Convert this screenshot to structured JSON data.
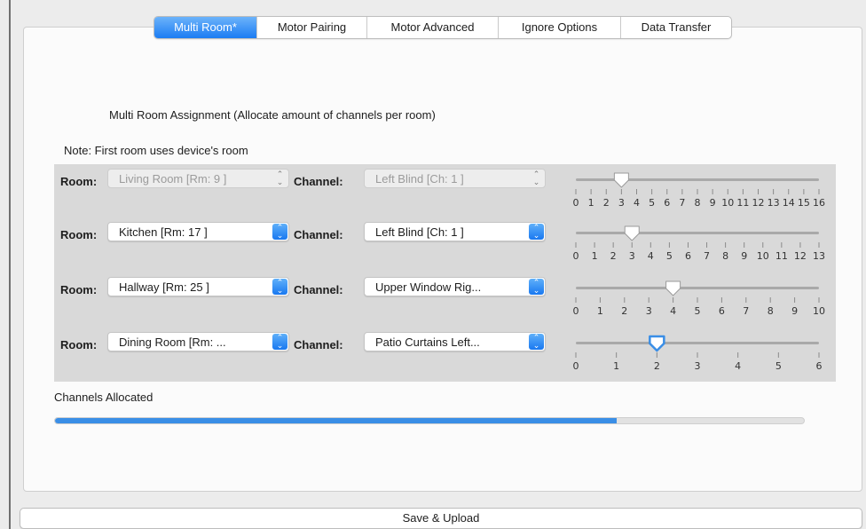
{
  "tabs": [
    {
      "label": "Multi Room*",
      "active": true
    },
    {
      "label": "Motor Pairing",
      "active": false
    },
    {
      "label": "Motor Advanced",
      "active": false
    },
    {
      "label": "Ignore Options",
      "active": false
    },
    {
      "label": "Data Transfer",
      "active": false
    }
  ],
  "assignment": {
    "title": "Multi Room Assignment (Allocate amount of channels per room)",
    "note": "Note: First room uses device's room"
  },
  "labels": {
    "room": "Room:",
    "channel": "Channel:"
  },
  "rows": [
    {
      "room": "Living Room [Rm: 9 ]",
      "channel": "Left Blind [Ch: 1 ]",
      "disabled": true,
      "slider": {
        "min": 0,
        "max": 16,
        "value": 3,
        "ticks": [
          "0",
          "1",
          "2",
          "3",
          "4",
          "5",
          "6",
          "7",
          "8",
          "9",
          "10",
          "11",
          "12",
          "13",
          "14",
          "15",
          "16"
        ]
      }
    },
    {
      "room": "Kitchen [Rm: 17 ]",
      "channel": "Left Blind [Ch: 1 ]",
      "disabled": false,
      "slider": {
        "min": 0,
        "max": 13,
        "value": 3,
        "ticks": [
          "0",
          "1",
          "2",
          "3",
          "4",
          "5",
          "6",
          "7",
          "8",
          "9",
          "10",
          "11",
          "12",
          "13"
        ]
      }
    },
    {
      "room": "Hallway [Rm: 25 ]",
      "channel": "Upper Window Rig...",
      "disabled": false,
      "slider": {
        "min": 0,
        "max": 10,
        "value": 4,
        "ticks": [
          "0",
          "1",
          "2",
          "3",
          "4",
          "5",
          "6",
          "7",
          "8",
          "9",
          "10"
        ]
      }
    },
    {
      "room": "Dining Room [Rm: ...",
      "channel": "Patio Curtains Left...",
      "disabled": false,
      "slider": {
        "min": 0,
        "max": 6,
        "value": 2,
        "focused": true,
        "ticks": [
          "0",
          "1",
          "2",
          "3",
          "4",
          "5",
          "6"
        ]
      }
    }
  ],
  "channels_allocated": {
    "label": "Channels Allocated",
    "fraction": 0.75
  },
  "save_button": "Save & Upload",
  "colors": {
    "accent": "#1b7cf3",
    "progress": "#3a8ee6",
    "panel": "#fbfbfb",
    "grid_bg": "#d9d9d9"
  }
}
